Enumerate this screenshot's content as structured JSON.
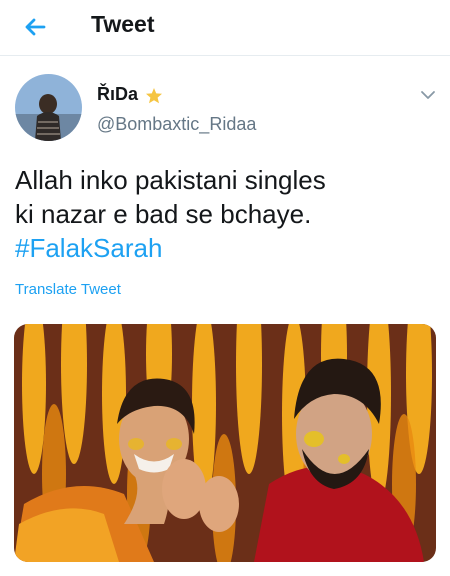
{
  "header": {
    "title": "Tweet",
    "back_icon": "back-arrow-icon"
  },
  "author": {
    "display_name": "ŘıDa",
    "emoji": "star-emoji",
    "handle": "@Bombaxtic_Ridaa"
  },
  "tweet": {
    "line1": "Allah inko pakistani singles",
    "line2": "ki nazar e bad se bchaye.",
    "hashtag": "#FalakSarah",
    "translate_label": "Translate Tweet"
  },
  "colors": {
    "accent": "#1da1f2",
    "text": "#14171a",
    "secondary": "#657786"
  }
}
